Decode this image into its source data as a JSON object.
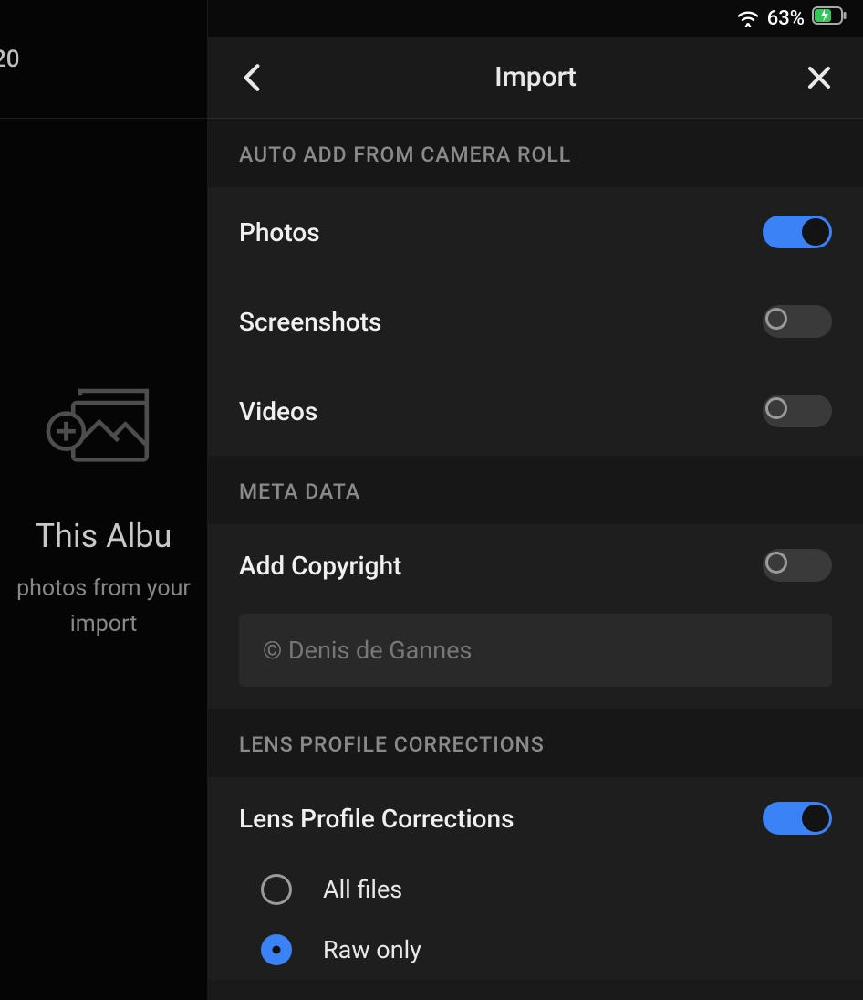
{
  "status_bar": {
    "battery_percent": "63%"
  },
  "background": {
    "top_number": "20",
    "title": "This Albu",
    "subtitle_line1": "photos from your",
    "subtitle_line2": "import"
  },
  "panel": {
    "title": "Import"
  },
  "sections": {
    "auto_add": {
      "header": "AUTO ADD FROM CAMERA ROLL",
      "items": [
        {
          "label": "Photos",
          "on": true
        },
        {
          "label": "Screenshots",
          "on": false
        },
        {
          "label": "Videos",
          "on": false
        }
      ]
    },
    "metadata": {
      "header": "META DATA",
      "add_copyright_label": "Add Copyright",
      "add_copyright_on": false,
      "copyright_value": "© Denis de Gannes"
    },
    "lens": {
      "header": "LENS PROFILE CORRECTIONS",
      "toggle_label": "Lens Profile Corrections",
      "toggle_on": true,
      "options": [
        {
          "label": "All files",
          "selected": false
        },
        {
          "label": "Raw only",
          "selected": true
        }
      ]
    }
  }
}
